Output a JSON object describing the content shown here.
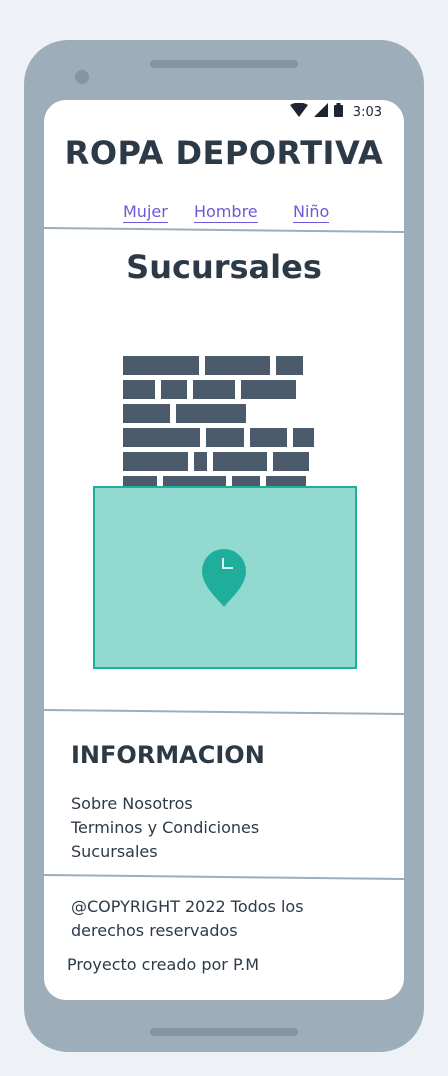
{
  "status": {
    "time": "3:03"
  },
  "header": {
    "brand": "ROPA DEPORTIVA"
  },
  "nav": {
    "items": [
      "Mujer",
      "Hombre",
      "Niño"
    ]
  },
  "main": {
    "title": "Sucursales"
  },
  "footer": {
    "info_title": "INFORMACION",
    "links": [
      "Sobre Nosotros",
      "Terminos y Condiciones",
      "Sucursales"
    ],
    "copyright": "@COPYRIGHT 2022 Todos los derechos reservados",
    "credit": "Proyecto creado por P.M"
  },
  "colors": {
    "text": "#2c3a48",
    "link": "#6b5ad8",
    "map_fill": "#92d9d0",
    "map_accent": "#1fae9b",
    "phone_frame": "#9eadba"
  },
  "icons": [
    "wifi-icon",
    "cell-signal-icon",
    "battery-icon",
    "map-pin-icon"
  ]
}
